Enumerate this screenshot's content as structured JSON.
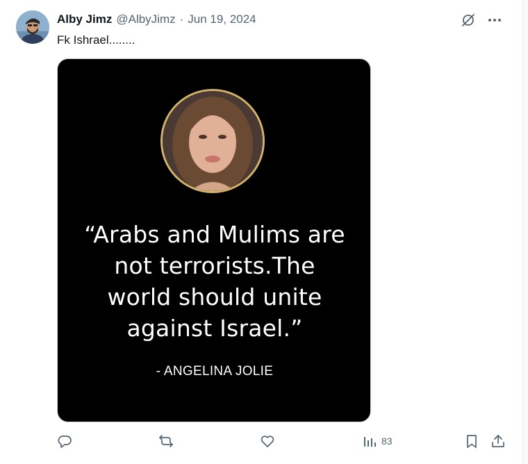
{
  "tweet": {
    "author_name": "Alby Jimz",
    "handle": "@AlbyJimz",
    "separator": "·",
    "date": "Jun 19, 2024",
    "text": "Fk Ishrael........",
    "media": {
      "quote_lines": [
        "“Arabs and Mulims are",
        "not terrorists.The",
        "world should unite",
        "against Israel.”"
      ],
      "attribution": "- ANGELINA JOLIE"
    },
    "stats": {
      "views": "83"
    }
  },
  "icons": {
    "top": [
      "grok-icon",
      "more-icon"
    ],
    "actions": [
      "reply-icon",
      "retweet-icon",
      "like-icon",
      "views-icon",
      "bookmark-icon",
      "share-icon"
    ]
  },
  "colors": {
    "muted": "#536471",
    "text": "#0f1419",
    "portrait_border": "#d4b36a"
  }
}
